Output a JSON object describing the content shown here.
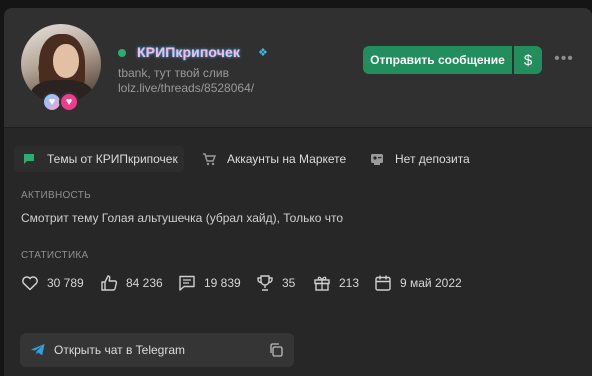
{
  "profile": {
    "username": "КРИПкрипочек",
    "status_text": "tbank, тут твой слив",
    "link": "lolz.live/threads/8528064/"
  },
  "actions": {
    "message_label": "Отправить сообщение",
    "dollar_label": "$",
    "more_label": "•••"
  },
  "tabs": [
    {
      "label": "Темы от КРИПкрипочек",
      "icon": "chat-bubble-icon",
      "color": "#2bad72"
    },
    {
      "label": "Аккаунты на Маркете",
      "icon": "cart-icon"
    },
    {
      "label": "Нет депозита",
      "icon": "id-card-icon"
    }
  ],
  "activity": {
    "title": "АКТИВНОСТЬ",
    "text": "Смотрит тему Голая альтушечка (убрал хайд), Только что"
  },
  "stats": {
    "title": "СТАТИСТИКА",
    "items": [
      {
        "icon": "heart-icon",
        "value": "30 789"
      },
      {
        "icon": "thumbs-up-icon",
        "value": "84 236"
      },
      {
        "icon": "message-icon",
        "value": "19 839"
      },
      {
        "icon": "trophy-icon",
        "value": "35"
      },
      {
        "icon": "gift-icon",
        "value": "213"
      },
      {
        "icon": "calendar-icon",
        "value": "9 май 2022"
      }
    ]
  },
  "telegram": {
    "label": "Открыть чат в Telegram"
  },
  "colors": {
    "accent": "#228e5d",
    "online": "#2bad72",
    "username": "#ffb8d9",
    "username_glow": "#2fb6ff"
  }
}
